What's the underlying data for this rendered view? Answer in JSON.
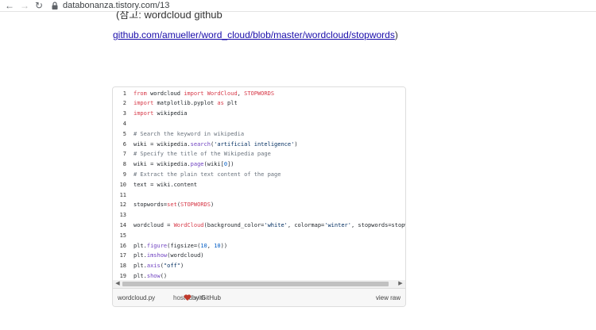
{
  "browser": {
    "back_icon": "arrow-left-icon",
    "forward_icon": "arrow-right-icon",
    "reload_icon": "reload-icon",
    "lock_icon": "lock-icon",
    "url": "databonanza.tistory.com/13"
  },
  "article": {
    "partial_heading": "(참고: wordcloud github",
    "reference_link": "github.com/amueller/word_cloud/blob/master/wordcloud/stopwords",
    "reference_close_paren": ")"
  },
  "gist": {
    "lines": [
      {
        "n": "1",
        "code": "from wordcloud import WordCloud, STOPWORDS"
      },
      {
        "n": "2",
        "code": "import matplotlib.pyplot as plt"
      },
      {
        "n": "3",
        "code": "import wikipedia"
      },
      {
        "n": "4",
        "code": ""
      },
      {
        "n": "5",
        "code": "# Search the keyword in wikipedia"
      },
      {
        "n": "6",
        "code": "wiki = wikipedia.search('artificial inteligence')"
      },
      {
        "n": "7",
        "code": "# Specify the title of the Wikipedia page"
      },
      {
        "n": "8",
        "code": "wiki = wikipedia.page(wiki[0])"
      },
      {
        "n": "9",
        "code": "# Extract the plain text content of the page"
      },
      {
        "n": "10",
        "code": "text = wiki.content"
      },
      {
        "n": "11",
        "code": ""
      },
      {
        "n": "12",
        "code": "stopwords=set(STOPWORDS)"
      },
      {
        "n": "13",
        "code": ""
      },
      {
        "n": "14",
        "code": "wordcloud = WordCloud(background_color='white', colormap='winter', stopwords=stopwords).ge"
      },
      {
        "n": "15",
        "code": ""
      },
      {
        "n": "16",
        "code": "plt.figure(figsize=(10, 10))"
      },
      {
        "n": "17",
        "code": "plt.imshow(wordcloud)"
      },
      {
        "n": "18",
        "code": "plt.axis(\"off\")"
      },
      {
        "n": "19",
        "code": "plt.show()"
      }
    ],
    "footer": {
      "file_link": "wordcloud.py",
      "hosted_with": "hosted with",
      "heart_icon": "heart-icon",
      "by": "by",
      "github_link": "GitHub",
      "view_raw": "view raw"
    }
  },
  "colors": {
    "link": "#1a0dab",
    "keyword": "#d73a49",
    "function": "#6f42c1",
    "comment": "#6a737d",
    "string": "#032f62",
    "number": "#005cc5",
    "heart": "#c0392b"
  }
}
